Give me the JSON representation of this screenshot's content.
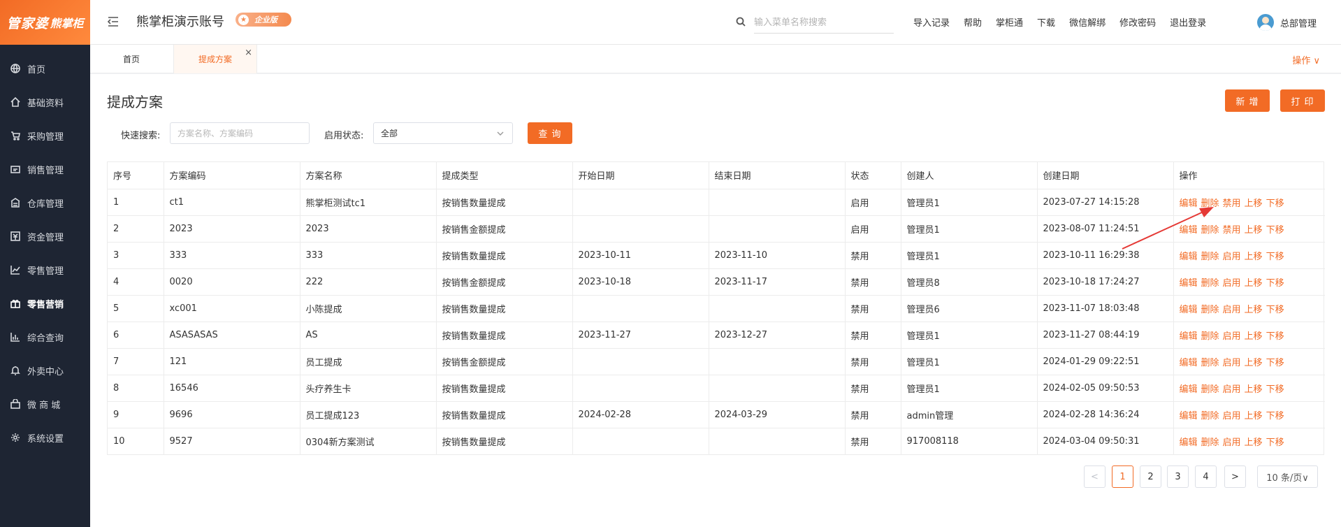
{
  "brand": {
    "logo_main": "管家婆",
    "logo_sub": "熊掌柜"
  },
  "sidebar": {
    "items": [
      {
        "label": "首页",
        "icon": "globe-icon"
      },
      {
        "label": "基础资料",
        "icon": "home-icon"
      },
      {
        "label": "采购管理",
        "icon": "cart-icon"
      },
      {
        "label": "销售管理",
        "icon": "sales-icon"
      },
      {
        "label": "仓库管理",
        "icon": "warehouse-icon"
      },
      {
        "label": "资金管理",
        "icon": "money-icon"
      },
      {
        "label": "零售管理",
        "icon": "chart-icon"
      },
      {
        "label": "零售营销",
        "icon": "gift-icon"
      },
      {
        "label": "综合查询",
        "icon": "bar-chart-icon"
      },
      {
        "label": "外卖中心",
        "icon": "bell-icon"
      },
      {
        "label": "微 商 城",
        "icon": "bag-icon"
      },
      {
        "label": "系统设置",
        "icon": "gear-icon"
      }
    ],
    "active_index": 7
  },
  "header": {
    "account_name": "熊掌柜演示账号",
    "badge": "企业版",
    "search_placeholder": "输入菜单名称搜索",
    "links": [
      "导入记录",
      "帮助",
      "掌柜通",
      "下载",
      "微信解绑",
      "修改密码",
      "退出登录"
    ],
    "user": "总部管理"
  },
  "tabs": {
    "home": "首页",
    "active": "提成方案",
    "close": "×",
    "ops": "操作 ∨"
  },
  "page": {
    "title": "提成方案",
    "add_button": "新 增",
    "print_button": "打 印",
    "quick_search_label": "快速搜索:",
    "quick_search_placeholder": "方案名称、方案编码",
    "status_label": "启用状态:",
    "status_value": "全部",
    "query_button": "查 询"
  },
  "table": {
    "columns": [
      "序号",
      "方案编码",
      "方案名称",
      "提成类型",
      "开始日期",
      "结束日期",
      "状态",
      "创建人",
      "创建日期",
      "操作"
    ],
    "rows": [
      [
        "1",
        "ct1",
        "熊掌柜测试tc1",
        "按销售数量提成",
        "",
        "",
        "启用",
        "管理员1",
        "2023-07-27 14:15:28"
      ],
      [
        "2",
        "2023",
        "2023",
        "按销售金额提成",
        "",
        "",
        "启用",
        "管理员1",
        "2023-08-07 11:24:51"
      ],
      [
        "3",
        "333",
        "333",
        "按销售数量提成",
        "2023-10-11",
        "2023-11-10",
        "禁用",
        "管理员1",
        "2023-10-11 16:29:38"
      ],
      [
        "4",
        "0020",
        "222",
        "按销售金额提成",
        "2023-10-18",
        "2023-11-17",
        "禁用",
        "管理员8",
        "2023-10-18 17:24:27"
      ],
      [
        "5",
        "xc001",
        "小陈提成",
        "按销售数量提成",
        "",
        "",
        "禁用",
        "管理员6",
        "2023-11-07 18:03:48"
      ],
      [
        "6",
        "ASASASAS",
        "AS",
        "按销售数量提成",
        "2023-11-27",
        "2023-12-27",
        "禁用",
        "管理员1",
        "2023-11-27 08:44:19"
      ],
      [
        "7",
        "121",
        "员工提成",
        "按销售金额提成",
        "",
        "",
        "禁用",
        "管理员1",
        "2024-01-29 09:22:51"
      ],
      [
        "8",
        "16546",
        "头疗养生卡",
        "按销售数量提成",
        "",
        "",
        "禁用",
        "管理员1",
        "2024-02-05 09:50:53"
      ],
      [
        "9",
        "9696",
        "员工提成123",
        "按销售数量提成",
        "2024-02-28",
        "2024-03-29",
        "禁用",
        "admin管理",
        "2024-02-28 14:36:24"
      ],
      [
        "10",
        "9527",
        "0304新方案测试",
        "按销售数量提成",
        "",
        "",
        "禁用",
        "917008118",
        "2024-03-04 09:50:31"
      ]
    ],
    "actions_enabled": [
      "编辑",
      "删除",
      "禁用",
      "上移",
      "下移"
    ],
    "actions_disabled": [
      "编辑",
      "删除",
      "启用",
      "上移",
      "下移"
    ]
  },
  "pagination": {
    "prev": "<",
    "pages": [
      "1",
      "2",
      "3",
      "4"
    ],
    "current": "1",
    "next": ">",
    "page_size": "10 条/页∨"
  },
  "colors": {
    "accent": "#f26b25",
    "sidebar_bg": "#1e2533",
    "annotation_arrow": "#e53935"
  }
}
